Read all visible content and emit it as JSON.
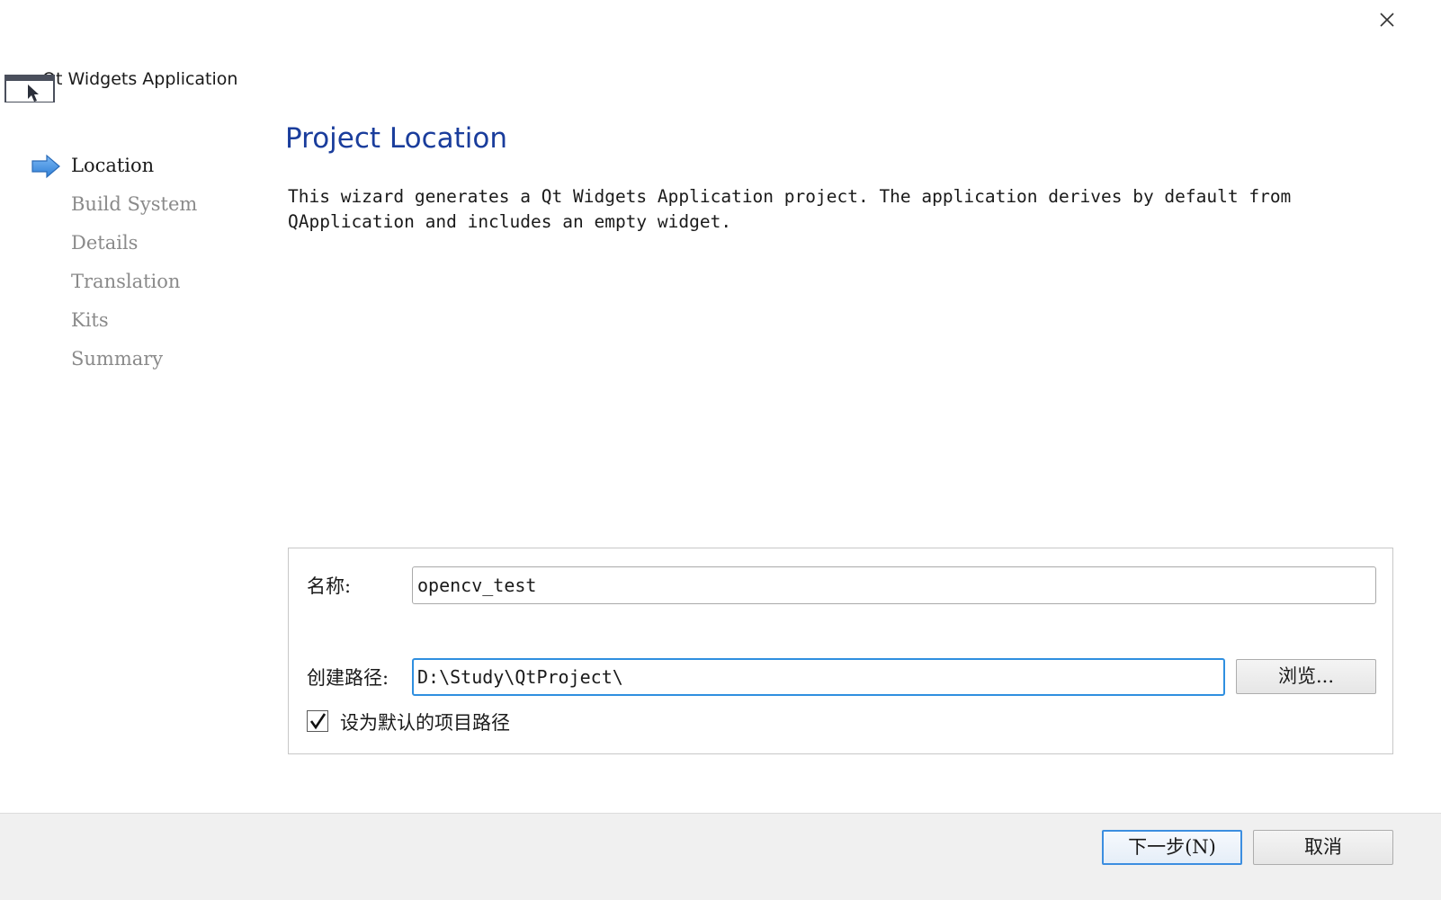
{
  "header": {
    "app_title": "Qt Widgets Application"
  },
  "steps": [
    {
      "label": "Location",
      "current": true
    },
    {
      "label": "Build System",
      "current": false
    },
    {
      "label": "Details",
      "current": false
    },
    {
      "label": "Translation",
      "current": false
    },
    {
      "label": "Kits",
      "current": false
    },
    {
      "label": "Summary",
      "current": false
    }
  ],
  "main": {
    "title": "Project Location",
    "description_line1": "This wizard generates a Qt Widgets Application project. The application derives by default from",
    "description_line2": "QApplication and includes an empty widget."
  },
  "form": {
    "name_label": "名称:",
    "name_value": "opencv_test",
    "path_label": "创建路径:",
    "path_value": "D:\\Study\\QtProject\\",
    "browse_label": "浏览...",
    "default_checkbox_label": "设为默认的项目路径",
    "default_checked": true
  },
  "footer": {
    "next_label": "下一步(N)",
    "cancel_label": "取消"
  },
  "colors": {
    "title_blue": "#1a3d9c",
    "focus_blue": "#2f8fe0",
    "arrow_blue": "#3a8ee6"
  },
  "icons": {
    "close": "close-icon",
    "app": "window-cursor-icon",
    "current_step": "arrow-right-icon",
    "check": "checkmark-icon"
  }
}
